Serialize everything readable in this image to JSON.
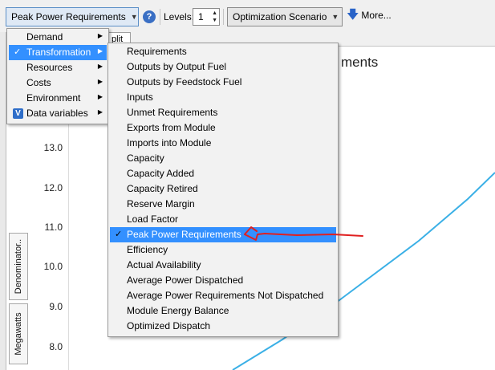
{
  "toolbar": {
    "type_select": "Peak Power Requirements",
    "levels_label": "Levels:",
    "levels_value": "1",
    "scenario_select": "Optimization Scenario",
    "more_label": "More..."
  },
  "tab_label": "plit",
  "chart": {
    "title_fragment": "ments",
    "y_ticks": [
      "13.0",
      "12.0",
      "11.0",
      "10.0",
      "9.0",
      "8.0"
    ],
    "side_tabs": [
      "Denominator..",
      "Megawatts"
    ],
    "line_color": "#3bb0e6",
    "annotation_color": "#e02020"
  },
  "menu_main": {
    "items": [
      {
        "label": "Demand",
        "checked": false,
        "submenu": true
      },
      {
        "label": "Transformation",
        "checked": true,
        "submenu": true,
        "highlighted": true
      },
      {
        "label": "Resources",
        "checked": false,
        "submenu": true
      },
      {
        "label": "Costs",
        "checked": false,
        "submenu": true
      },
      {
        "label": "Environment",
        "checked": false,
        "submenu": true
      },
      {
        "label": "Data variables",
        "checked": false,
        "submenu": true,
        "icon": "v-icon"
      }
    ]
  },
  "menu_sub": {
    "items": [
      {
        "label": "Requirements"
      },
      {
        "label": "Outputs by Output Fuel"
      },
      {
        "label": "Outputs by Feedstock Fuel"
      },
      {
        "label": "Inputs"
      },
      {
        "label": "Unmet Requirements"
      },
      {
        "label": "Exports from Module"
      },
      {
        "label": "Imports into Module"
      },
      {
        "label": "Capacity"
      },
      {
        "label": "Capacity Added"
      },
      {
        "label": "Capacity Retired"
      },
      {
        "label": "Reserve Margin"
      },
      {
        "label": "Load Factor"
      },
      {
        "label": "Peak Power Requirements",
        "checked": true,
        "highlighted": true
      },
      {
        "label": "Efficiency"
      },
      {
        "label": "Actual Availability"
      },
      {
        "label": "Average Power Dispatched"
      },
      {
        "label": "Average Power Requirements Not Dispatched"
      },
      {
        "label": "Module Energy Balance"
      },
      {
        "label": "Optimized Dispatch"
      }
    ]
  },
  "colors": {
    "menu_highlight": "#3390ff",
    "icon_blue": "#2f6ec9"
  }
}
